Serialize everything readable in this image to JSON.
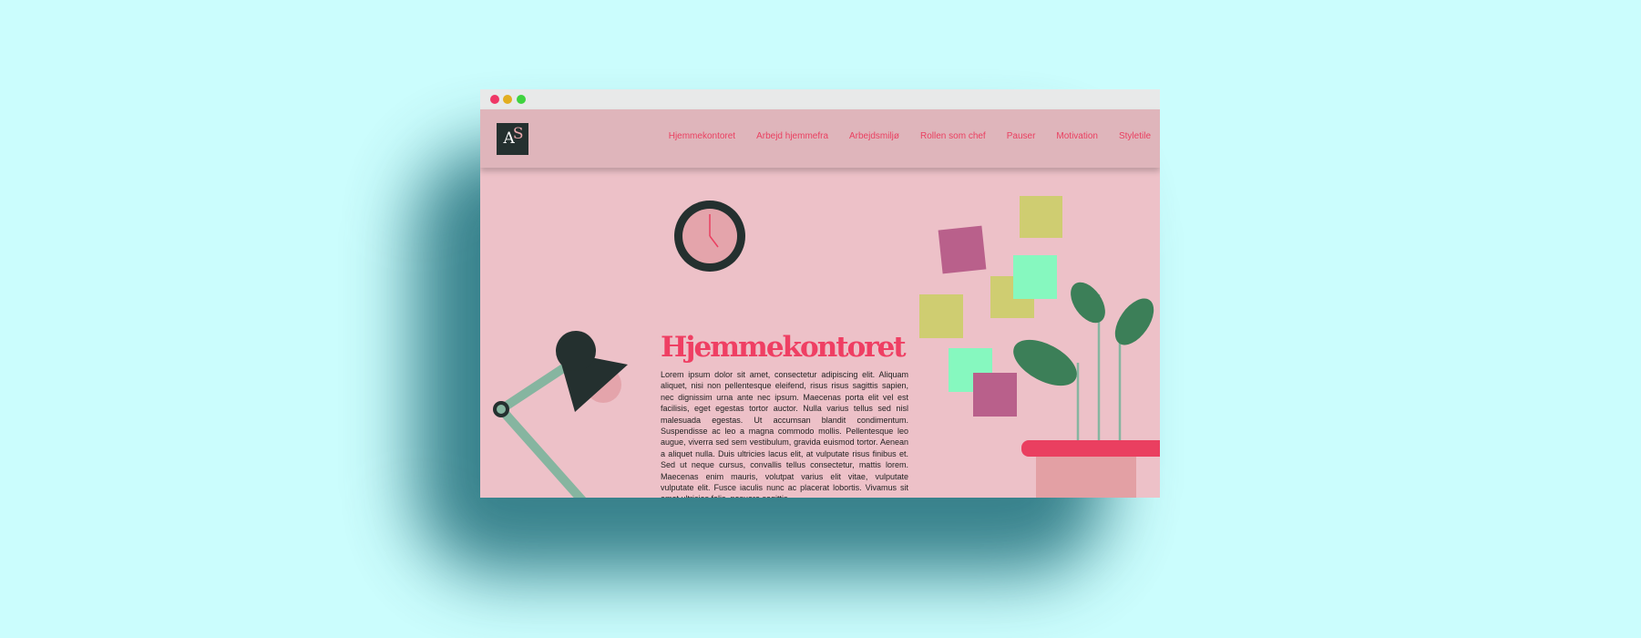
{
  "window": {
    "controls": [
      "close",
      "minimize",
      "maximize"
    ]
  },
  "logo": {
    "letter_a": "A",
    "letter_s": "S"
  },
  "nav": {
    "links": [
      "Hjemmekontoret",
      "Arbejd hjemmefra",
      "Arbejdsmiljø",
      "Rollen som chef",
      "Pauser",
      "Motivation",
      "Styletile"
    ]
  },
  "hero": {
    "heading": "Hjemmekontoret",
    "body": "Lorem ipsum dolor sit amet, consectetur adipiscing elit. Aliquam aliquet, nisi non pellentesque eleifend, risus risus sagittis sapien, nec dignissim urna ante nec ipsum. Maecenas porta elit vel est facilisis, eget egestas tortor auctor. Nulla varius tellus sed nisl malesuada egestas. Ut accumsan blandit condimentum. Suspendisse ac leo a magna commodo mollis. Pellentesque leo augue, viverra sed sem vestibulum, gravida euismod tortor. Aenean a aliquet nulla. Duis ultricies lacus elit, at vulputate risus finibus et. Sed ut neque cursus, convallis tellus consectetur, mattis lorem. Maecenas enim mauris, volutpat varius elit vitae, vulputate vulputate elit. Fusce iaculis nunc ac placerat lobortis. Vivamus sit amet ultricies felis, posuere sagittis"
  },
  "colors": {
    "background": "#cbfdfd",
    "page": "#edc1c8",
    "nav": "#dfb5bb",
    "accent": "#ea3f60",
    "dark": "#24302f",
    "sticky_yellow": "#cfcd71",
    "sticky_mint": "#86f8bf",
    "sticky_plum": "#b9608b",
    "plant_green": "#3c7f58"
  },
  "icons": [
    "clock-icon",
    "desk-lamp-icon",
    "sticky-notes-icon",
    "plant-icon"
  ]
}
